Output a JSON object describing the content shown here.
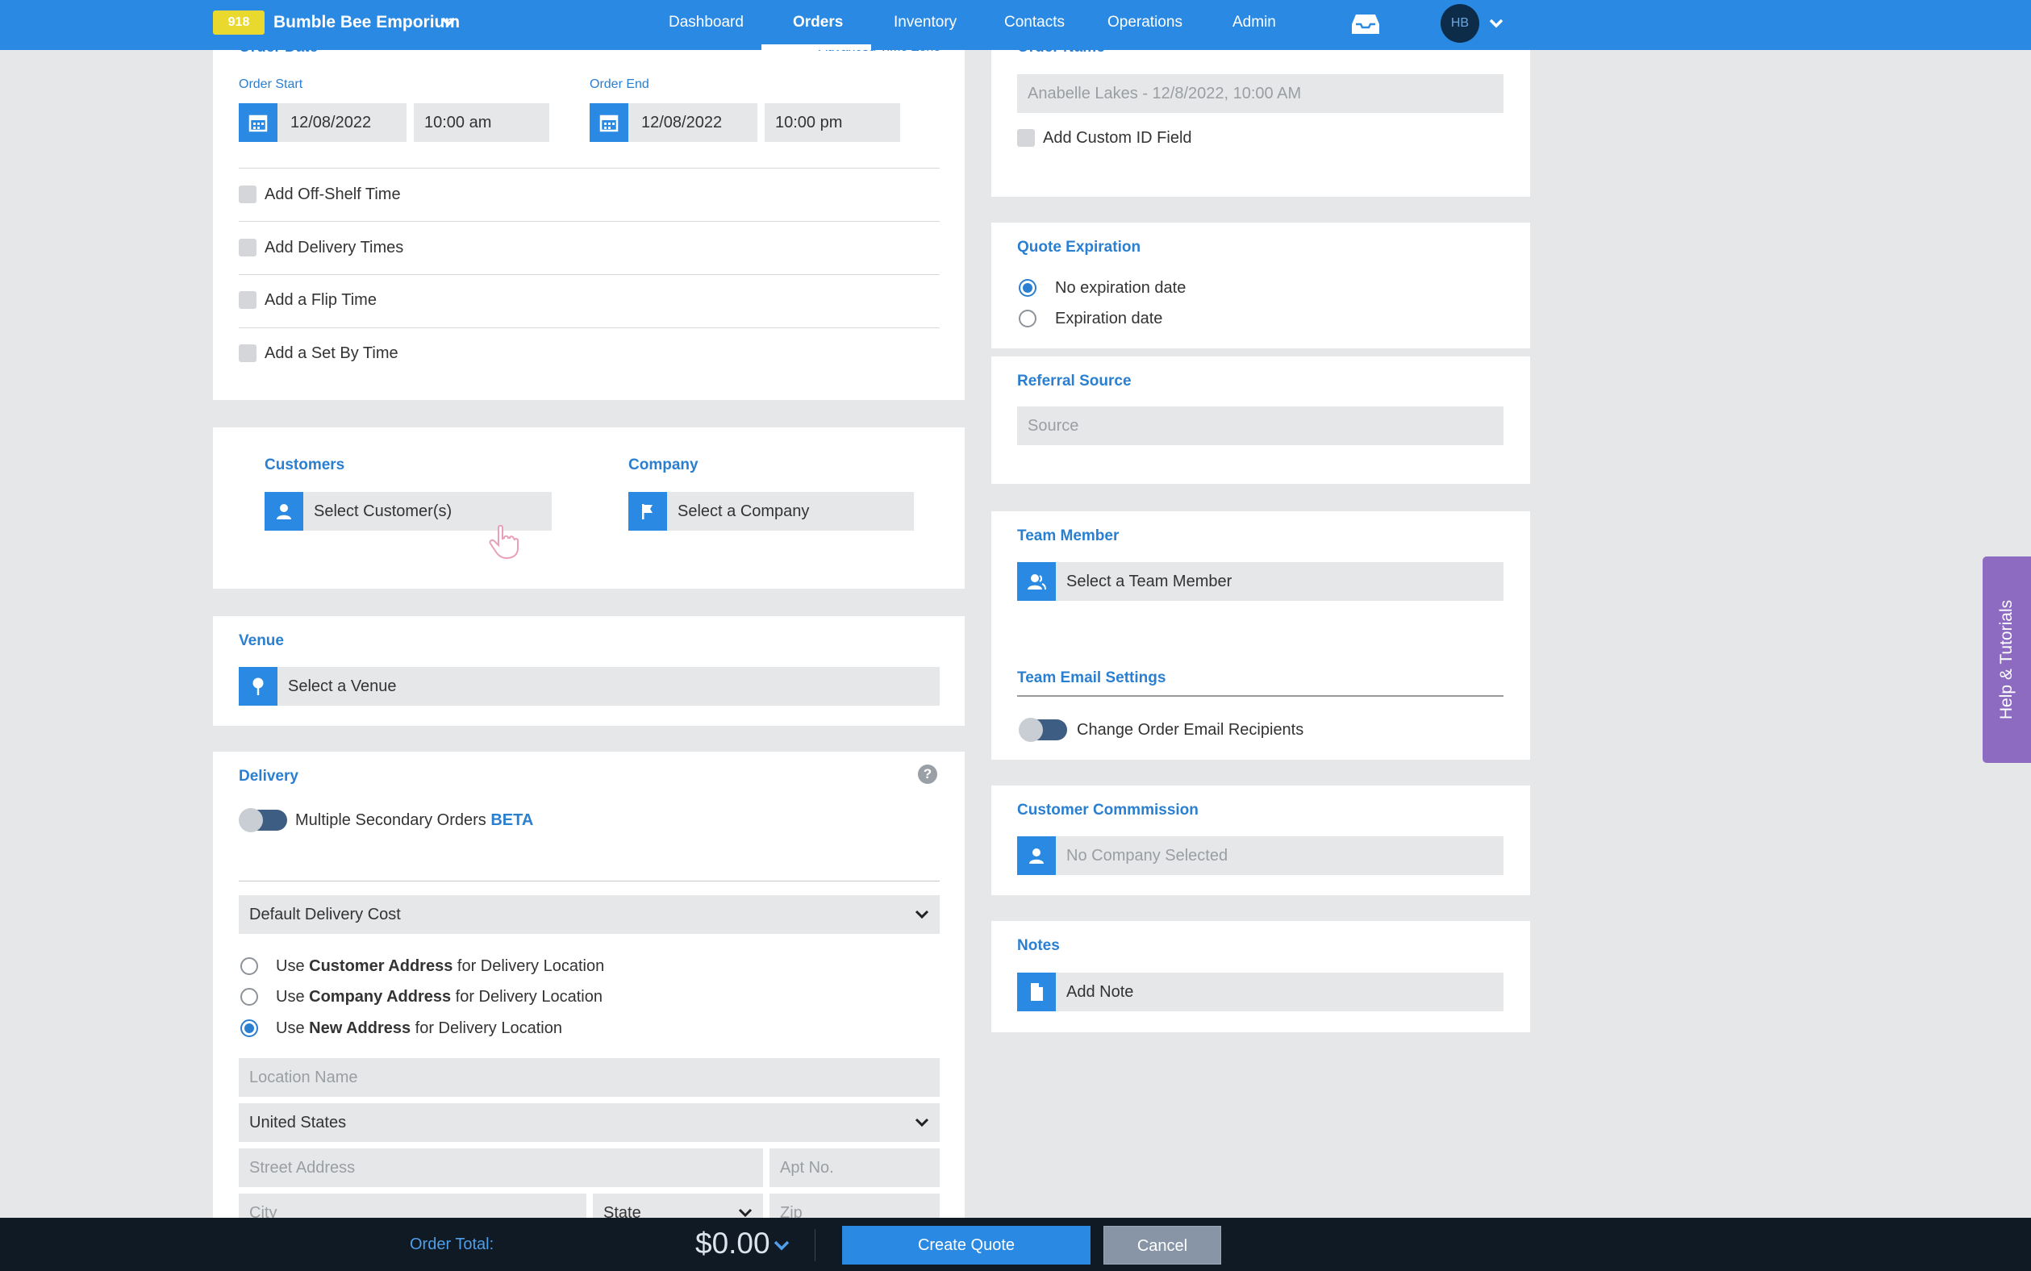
{
  "nav": {
    "badge": "918",
    "brand": "Bumble Bee Emporium",
    "items": [
      "Dashboard",
      "Orders",
      "Inventory",
      "Contacts",
      "Operations",
      "Admin"
    ],
    "active": "Orders",
    "avatar": "HB"
  },
  "order_date": {
    "heading_cut": "Order Date",
    "advanced_link": "Advanced Time Zone",
    "start_label": "Order Start",
    "start_date": "12/08/2022",
    "start_time": "10:00 am",
    "end_label": "Order End",
    "end_date": "12/08/2022",
    "end_time": "10:00 pm",
    "options": [
      "Add Off-Shelf Time",
      "Add Delivery Times",
      "Add a Flip Time",
      "Add a Set By Time"
    ]
  },
  "customers": {
    "customers_heading": "Customers",
    "customers_placeholder": "Select Customer(s)",
    "company_heading": "Company",
    "company_placeholder": "Select a Company"
  },
  "venue": {
    "heading": "Venue",
    "placeholder": "Select a Venue"
  },
  "delivery": {
    "heading": "Delivery",
    "toggle_label": "Multiple Secondary Orders",
    "beta": "BETA",
    "cost_select": "Default Delivery Cost",
    "address_options": [
      {
        "pre": "Use ",
        "bold": "Customer Address",
        "post": " for Delivery Location",
        "selected": false
      },
      {
        "pre": "Use ",
        "bold": "Company Address",
        "post": " for Delivery Location",
        "selected": false
      },
      {
        "pre": "Use ",
        "bold": "New Address",
        "post": " for Delivery Location",
        "selected": true
      }
    ],
    "location_name_ph": "Location Name",
    "country": "United States",
    "street_ph": "Street Address",
    "apt_ph": "Apt No.",
    "city_ph": "City",
    "state": "State",
    "zip_ph": "Zip"
  },
  "order_name": {
    "heading_cut": "Order Name",
    "value": "Anabelle Lakes - 12/8/2022, 10:00 AM",
    "custom_id": "Add Custom ID Field"
  },
  "quote_expiration": {
    "heading": "Quote Expiration",
    "options": [
      "No expiration date",
      "Expiration date"
    ],
    "selected": 0
  },
  "referral": {
    "heading": "Referral Source",
    "placeholder": "Source"
  },
  "team": {
    "heading": "Team Member",
    "placeholder": "Select a Team Member",
    "email_heading": "Team Email Settings",
    "email_toggle": "Change Order Email Recipients"
  },
  "commission": {
    "heading": "Customer Commmission",
    "placeholder": "No Company Selected"
  },
  "notes": {
    "heading": "Notes",
    "placeholder": "Add Note"
  },
  "help_tab": "Help & Tutorials",
  "footer": {
    "total_label": "Order Total:",
    "total_value": "$0.00",
    "create_button": "Create Quote",
    "cancel_button": "Cancel"
  },
  "colors": {
    "brand_blue": "#2a8ae3",
    "badge_yellow": "#e9d82e",
    "help_purple": "#8d6bc1",
    "footer_dark": "#101a25"
  }
}
